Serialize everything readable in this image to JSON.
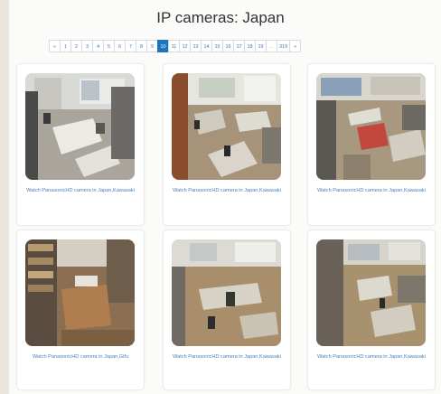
{
  "page": {
    "title": "IP cameras: Japan"
  },
  "pagination": {
    "prev": "«",
    "pages": [
      "1",
      "2",
      "3",
      "4",
      "5",
      "6",
      "7",
      "8",
      "9",
      "10",
      "11",
      "12",
      "13",
      "14",
      "15",
      "16",
      "17",
      "18",
      "19",
      "...",
      "319"
    ],
    "active": "10",
    "next": "»"
  },
  "cameras": [
    {
      "caption": "Watch PanasonicHD camera in Japan,Kawasaki"
    },
    {
      "caption": "Watch PanasonicHD camera in Japan,Kawasaki"
    },
    {
      "caption": "Watch PanasonicHD camera in Japan,Kawasaki"
    },
    {
      "caption": "Watch PanasonicHD camera in Japan,Gifu"
    },
    {
      "caption": "Watch PanasonicHD camera in Japan,Kawasaki"
    },
    {
      "caption": "Watch PanasonicHD camera in Japan,Kawasaki"
    }
  ],
  "colors": {
    "link": "#4a7fb8",
    "active_page": "#1d73be"
  }
}
